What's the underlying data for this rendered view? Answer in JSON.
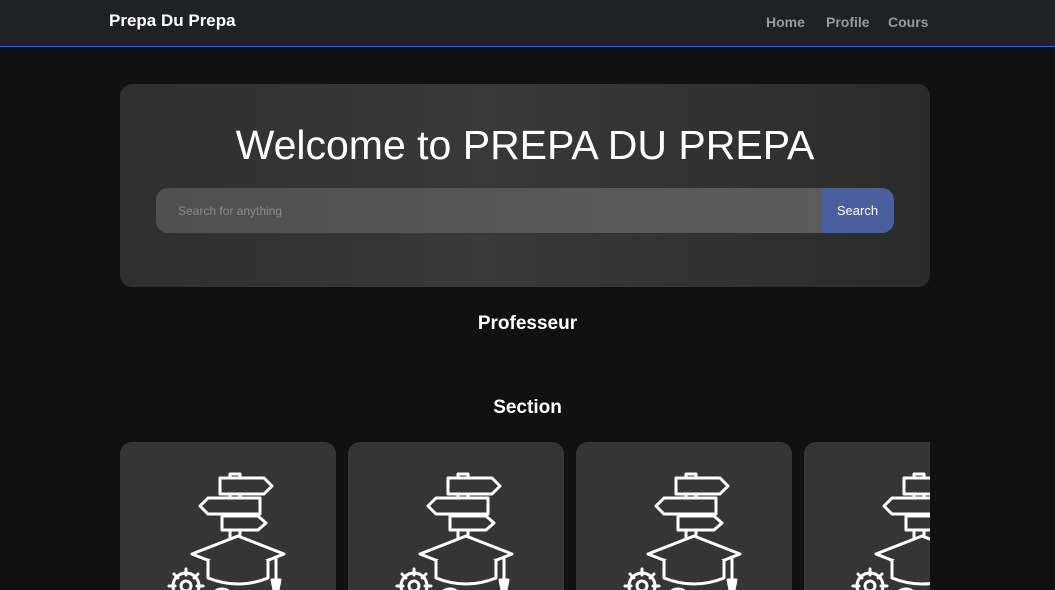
{
  "navbar": {
    "brand": "Prepa Du Prepa",
    "links": [
      {
        "label": "Home"
      },
      {
        "label": "Profile"
      },
      {
        "label": "Cours"
      }
    ]
  },
  "hero": {
    "title": "Welcome to PREPA DU PREPA",
    "search": {
      "placeholder": "Search for anything",
      "value": "",
      "button_label": "Search"
    }
  },
  "headings": {
    "professeur": "Professeur",
    "section": "Section"
  },
  "cards": [
    {
      "icon": "education-signpost-icon"
    },
    {
      "icon": "education-signpost-icon"
    },
    {
      "icon": "education-signpost-icon"
    },
    {
      "icon": "education-signpost-icon"
    }
  ],
  "colors": {
    "navbar_bg": "#1f2124",
    "navbar_border": "#3a66c6",
    "page_bg": "#111111",
    "hero_bg": "#333333",
    "search_button": "#4a5f9c",
    "card_bg": "#353535"
  }
}
